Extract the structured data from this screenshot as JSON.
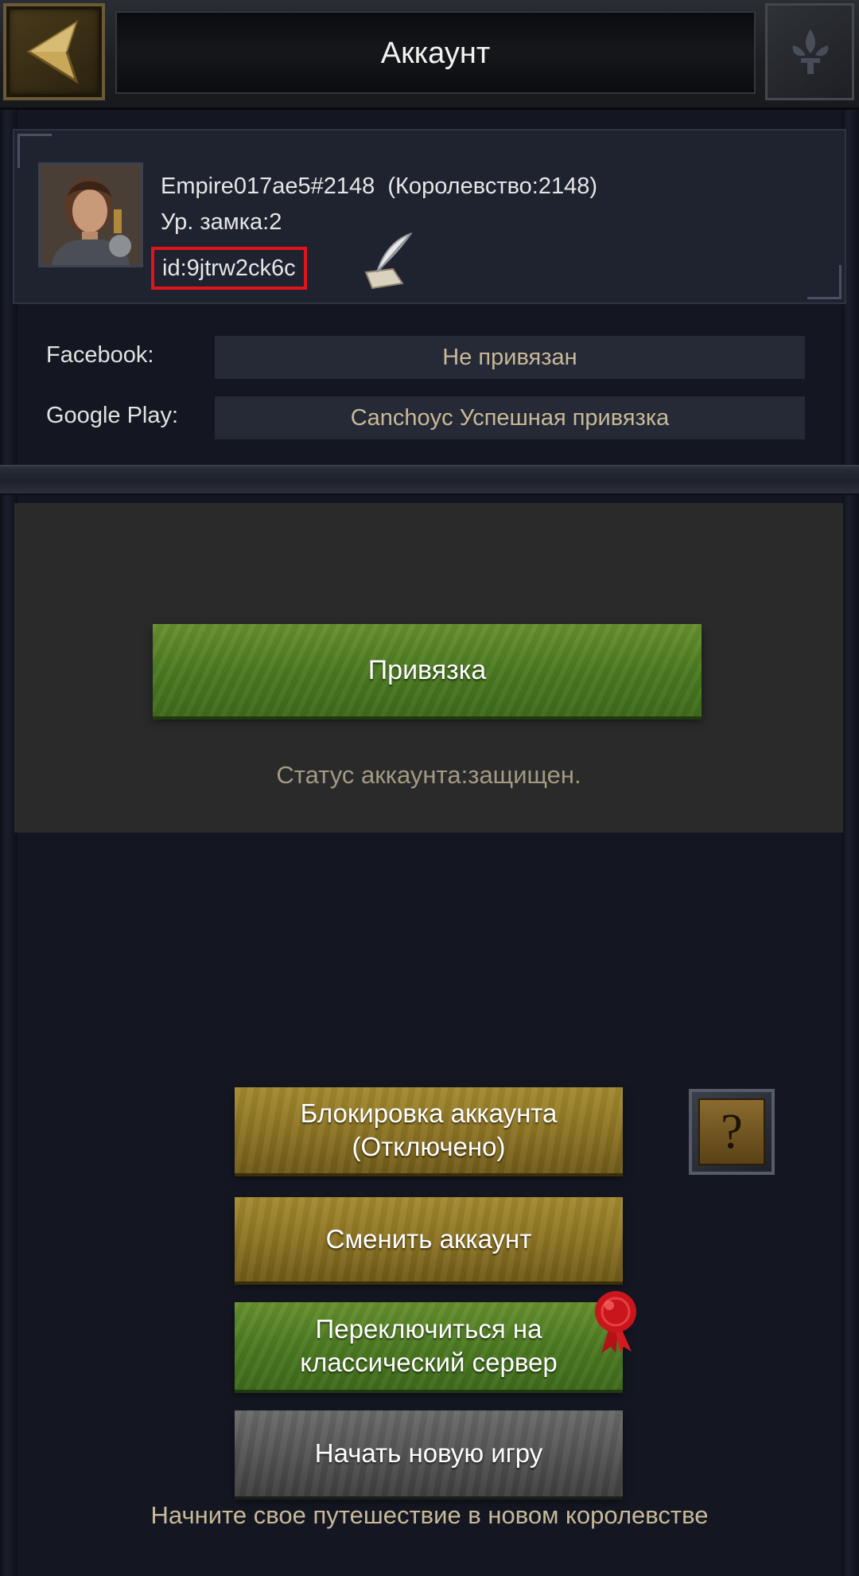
{
  "header": {
    "title": "Аккаунт"
  },
  "profile": {
    "name": "Empire017ae5#2148  (Королевство:2148)",
    "castle_level": "Ур. замка:2",
    "account_id": "id:9jtrw2ck6c"
  },
  "bindings": [
    {
      "label": "Facebook:",
      "value": "Не привязан"
    },
    {
      "label": "Google Play:",
      "value": "Canchoyc Успешная привязка"
    }
  ],
  "bind_section": {
    "button_label": "Привязка",
    "status": "Статус аккаунта:защищен."
  },
  "actions": {
    "lock_line1": "Блокировка аккаунта",
    "lock_line2": "(Отключено)",
    "help_label": "?",
    "switch_account": "Сменить аккаунт",
    "classic_line1": "Переключиться на",
    "classic_line2": "классический сервер",
    "new_game": "Начать новую игру",
    "new_game_hint": "Начните свое путешествие в новом королевстве"
  },
  "icons": {
    "back": "chevron-left-icon",
    "decor": "fleur-de-lis-icon",
    "edit": "quill-icon",
    "help": "question-icon",
    "badge": "wax-seal-icon"
  },
  "colors": {
    "id_highlight": "#e0141c",
    "green_button": "#4c7a22",
    "gold_button": "#8d7424",
    "gray_button": "#545454"
  }
}
